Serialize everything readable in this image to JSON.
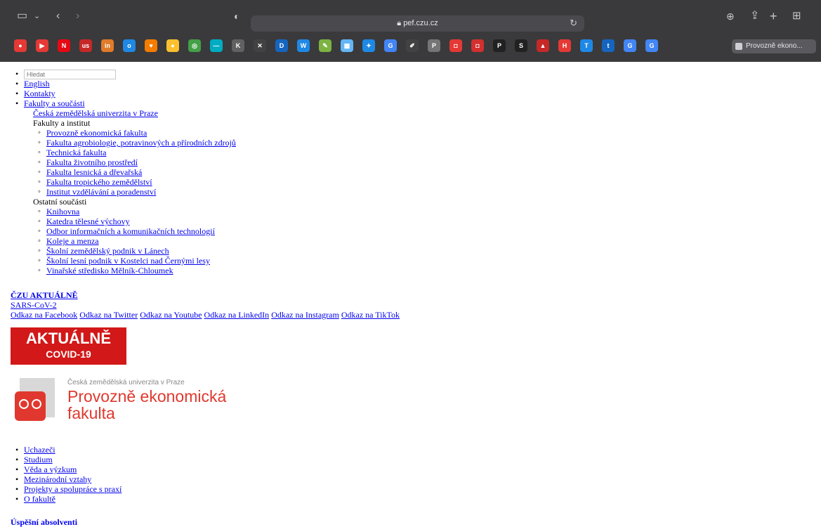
{
  "browser": {
    "address": "pef.czu.cz",
    "favorites_tab_label": "Provozně ekono...",
    "favicons": [
      {
        "name": "red-circle-favicon",
        "glyph": "●",
        "color": "#e53935"
      },
      {
        "name": "youtube-favicon",
        "glyph": "▶",
        "color": "#e53935"
      },
      {
        "name": "netflix-favicon",
        "glyph": "N",
        "color": "#e50914"
      },
      {
        "name": "us-favicon",
        "glyph": "us",
        "color": "#c62828"
      },
      {
        "name": "orange-favicon",
        "glyph": "in",
        "color": "#e07b2a"
      },
      {
        "name": "blue-favicon",
        "glyph": "o",
        "color": "#1e88e5"
      },
      {
        "name": "heart-favicon",
        "glyph": "♥",
        "color": "#f57c00"
      },
      {
        "name": "yellow-circle-favicon",
        "glyph": "●",
        "color": "#fbc02d"
      },
      {
        "name": "green-favicon",
        "glyph": "◎",
        "color": "#43a047"
      },
      {
        "name": "cyan-favicon",
        "glyph": "—",
        "color": "#00acc1"
      },
      {
        "name": "k-favicon",
        "glyph": "K",
        "color": "#616161"
      },
      {
        "name": "x-favicon",
        "glyph": "✕",
        "color": "#424242"
      },
      {
        "name": "d-favicon",
        "glyph": "D",
        "color": "#1565c0"
      },
      {
        "name": "w-favicon",
        "glyph": "W",
        "color": "#1e88e5"
      },
      {
        "name": "doc-favicon",
        "glyph": "✎",
        "color": "#7cb342"
      },
      {
        "name": "sheet-favicon",
        "glyph": "▦",
        "color": "#64b5f6"
      },
      {
        "name": "accessibility-favicon",
        "glyph": "✦",
        "color": "#1e88e5"
      },
      {
        "name": "google-favicon",
        "glyph": "G",
        "color": "#4285f4"
      },
      {
        "name": "pencil-favicon",
        "glyph": "✐",
        "color": "#424242"
      },
      {
        "name": "p-favicon",
        "glyph": "P",
        "color": "#757575"
      },
      {
        "name": "red-box-favicon",
        "glyph": "◘",
        "color": "#e53935"
      },
      {
        "name": "red-box2-favicon",
        "glyph": "◘",
        "color": "#d32f2f"
      },
      {
        "name": "p-black-favicon",
        "glyph": "P",
        "color": "#212121"
      },
      {
        "name": "s-favicon",
        "glyph": "S",
        "color": "#212121"
      },
      {
        "name": "triangle-favicon",
        "glyph": "▲",
        "color": "#c62828"
      },
      {
        "name": "h-favicon",
        "glyph": "H",
        "color": "#e53935"
      },
      {
        "name": "t-favicon",
        "glyph": "T",
        "color": "#1e88e5"
      },
      {
        "name": "t2-favicon",
        "glyph": "t",
        "color": "#1565c0"
      },
      {
        "name": "google2-favicon",
        "glyph": "G",
        "color": "#4285f4"
      },
      {
        "name": "google3-favicon",
        "glyph": "G",
        "color": "#4285f4"
      }
    ]
  },
  "search": {
    "placeholder": "Hledat"
  },
  "top_links": {
    "english": "English",
    "contacts": "Kontakty",
    "faculties": "Fakulty a součásti"
  },
  "university_link": "Česká zemědělská univerzita v Praze",
  "faculties_heading": "Fakulty a institut",
  "faculties": [
    "Provozně ekonomická fakulta",
    "Fakulta agrobiologie, potravinových a přírodních zdrojů",
    "Technická fakulta",
    "Fakulta životního prostředí",
    "Fakulta lesnická a dřevařská",
    "Fakulta tropického zemědělství",
    "Institut vzdělávání a poradenství"
  ],
  "other_heading": "Ostatní součásti",
  "other": [
    "Knihovna",
    "Katedra tělesné výchovy",
    "Odbor informačních a komunikačních technologií",
    "Koleje a menza",
    "Školní zemědělský podnik v Lánech",
    "Školní lesní podnik v Kostelci nad Černými lesy",
    "Vinařské středisko Mělník-Chloumek"
  ],
  "news": {
    "title": "ČZU AKTUÁLNĚ",
    "sars": "SARS-CoV-2"
  },
  "social": [
    "Odkaz na Facebook",
    "Odkaz na Twitter",
    "Odkaz na Youtube",
    "Odkaz na LinkedIn",
    "Odkaz na Instagram",
    "Odkaz na TikTok"
  ],
  "covid_banner": {
    "title": "AKTUÁLNĚ",
    "subtitle": "COVID-19"
  },
  "logo": {
    "university": "Česká zemědělská univerzita v Praze",
    "line1": "Provozně ekonomická",
    "line2": "fakulta"
  },
  "main_nav": [
    "Uchazeči",
    "Studium",
    "Věda a výzkum",
    "Mezinárodní vztahy",
    "Projekty a spolupráce s praxí",
    "O fakultě"
  ],
  "bottom_heading": "Úspěšní absolventi"
}
